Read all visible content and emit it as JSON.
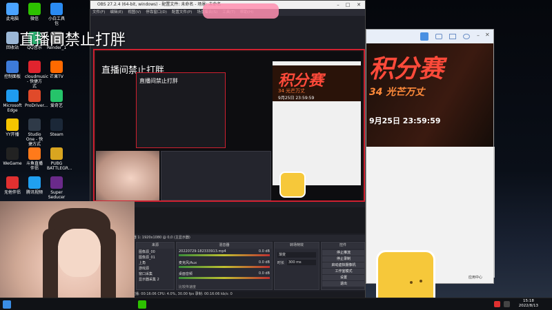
{
  "overlay_title": "直播间禁止打胖",
  "desktop_icons": [
    {
      "label": "此电脑",
      "color": "#4aa3ff"
    },
    {
      "label": "微信",
      "color": "#2dc100"
    },
    {
      "label": "小白工具包",
      "color": "#2a8bf2"
    },
    {
      "label": "回收站",
      "color": "#9bb7d6"
    },
    {
      "label": "QQ音乐",
      "color": "#31c27c"
    },
    {
      "label": "Render_1",
      "color": "#888888"
    },
    {
      "label": "控制面板",
      "color": "#3d7bd9"
    },
    {
      "label": "cloudmusic - 快捷方式",
      "color": "#e0242e"
    },
    {
      "label": "芒果TV",
      "color": "#ff6a00"
    },
    {
      "label": "Microsoft Edge",
      "color": "#1f9cf0"
    },
    {
      "label": "ProDriver...",
      "color": "#e04a2a"
    },
    {
      "label": "爱奇艺",
      "color": "#25c46a"
    },
    {
      "label": "YY开播",
      "color": "#f5c400"
    },
    {
      "label": "Studio One - 快捷方式",
      "color": "#2f3a48"
    },
    {
      "label": "Steam",
      "color": "#1b2838"
    },
    {
      "label": "WeGame",
      "color": "#222222"
    },
    {
      "label": "斗鱼直播伴侣",
      "color": "#ff7a1a"
    },
    {
      "label": "PUBG BATTLEGR...",
      "color": "#d9a520"
    },
    {
      "label": "无他伴侣",
      "color": "#e03030"
    },
    {
      "label": "腾讯视频",
      "color": "#20a0f0"
    },
    {
      "label": "Super Seducer",
      "color": "#6a2a8a"
    }
  ],
  "obs": {
    "title": "OBS 27.2.4 (64-bit, windows) - 配置文件: 未命名 - 场景: 未命名",
    "menu": [
      "文件(F)",
      "编辑(E)",
      "视图(V)",
      "停靠窗口(D)",
      "配置文件(P)",
      "场景集合(S)",
      "工具(T)",
      "帮助(H)"
    ],
    "preview_title": "直播间禁止打胖",
    "toolbar_text": "⚙属性  ⚙滤镜  显示器  显示器 1: 1920x1080 @ 0,0 (主显示器)",
    "scenes_header": "来源",
    "sources": [
      "图像源_00",
      "图像源_01",
      "上角",
      "游戏源",
      "窗口采集",
      "显示器采集 2"
    ],
    "mixer_header": "混音器",
    "mixer": [
      {
        "name": "20220729-182333913.mp4",
        "level": "0.0 dB"
      },
      {
        "name": "麦克风/Aux",
        "level": "0.0 dB"
      },
      {
        "name": "桌面音频",
        "level": "0.0 dB"
      }
    ],
    "transition_header": "转场特效",
    "transition_type": "渐变",
    "transition_duration_label": "时长",
    "transition_duration": "300 ms",
    "controls_header": "控件",
    "controls": [
      "停止推流",
      "停止录制",
      "启动虚拟摄像机",
      "工作室模式",
      "设置",
      "退出"
    ],
    "status": "直播: 00:16:06   CPU: 4.0%, 30.00 fps   录制: 00:16:06   kb/s: 0",
    "mixer_footer": "比较传速度"
  },
  "browser": {
    "banner_big": "积分赛",
    "banner_sub": "34 光芒万丈",
    "banner_date": "9月25日 23:59:59",
    "footer": "应用中心"
  },
  "taskbar": {
    "time": "15:18",
    "date": "2022/8/13"
  }
}
